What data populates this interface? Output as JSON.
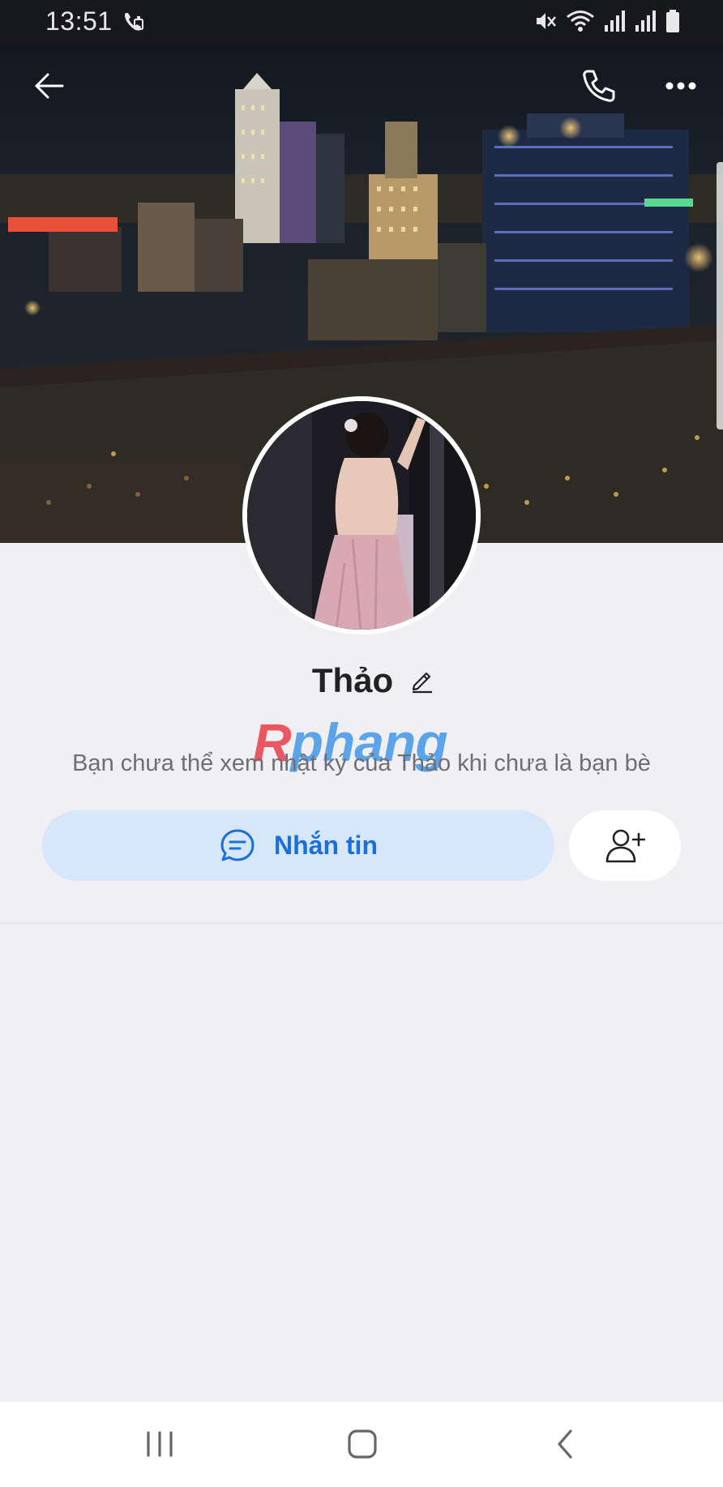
{
  "status_bar": {
    "time": "13:51"
  },
  "profile": {
    "name": "Thảo",
    "info_text": "Bạn chưa thể xem nhật ký của Thảo khi chưa là bạn bè"
  },
  "actions": {
    "message_label": "Nhắn tin"
  },
  "watermark": {
    "first": "R",
    "rest": "phang"
  },
  "icons": {
    "back": "arrow-left-icon",
    "call": "phone-icon",
    "more": "more-horizontal-icon",
    "edit": "pencil-icon",
    "chat": "chat-bubble-icon",
    "add_friend": "user-plus-icon",
    "status": [
      "wifi-call-icon",
      "mute-icon",
      "wifi-icon",
      "signal-icon",
      "signal-icon",
      "battery-icon"
    ],
    "nav": [
      "recents-icon",
      "home-icon",
      "back-icon"
    ]
  },
  "colors": {
    "accent": "#1a6fdb",
    "message_button_bg": "#d7e7fb",
    "page_bg": "#f0eff4"
  }
}
